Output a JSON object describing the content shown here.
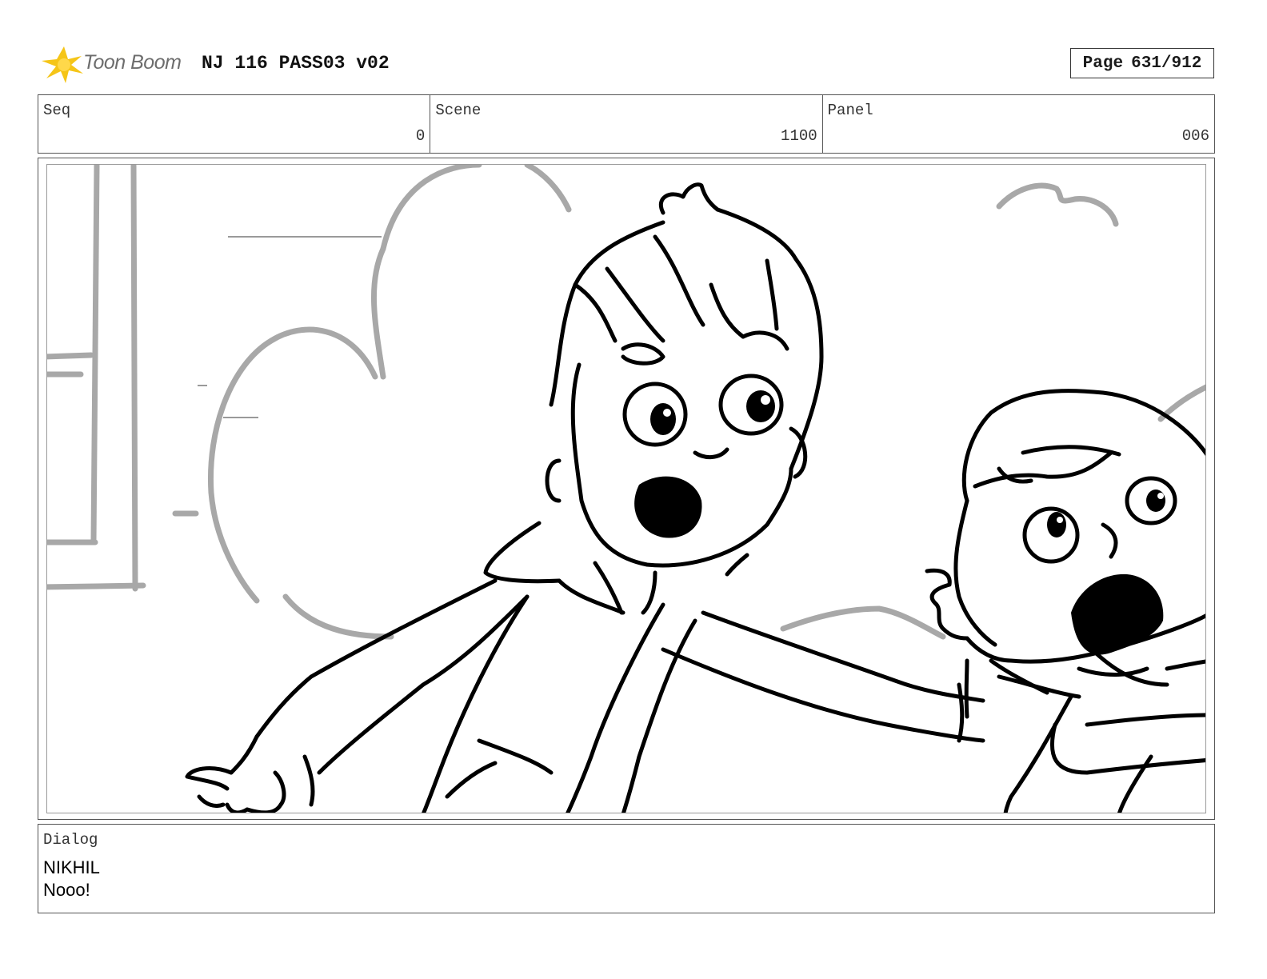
{
  "header": {
    "logo_text": "Toon Boom",
    "title": "NJ 116 PASS03 v02",
    "page_label": "Page",
    "page_value": "631/912"
  },
  "info": {
    "seq_label": "Seq",
    "seq_value": "0",
    "scene_label": "Scene",
    "scene_value": "1100",
    "panel_label": "Panel",
    "panel_value": "006"
  },
  "dialog": {
    "label": "Dialog",
    "character": "NIKHIL",
    "line": "Nooo!"
  },
  "colors": {
    "logo_star": "#f5c518",
    "sketch_ink": "#000000",
    "background_sketch": "#a8a8a8"
  }
}
